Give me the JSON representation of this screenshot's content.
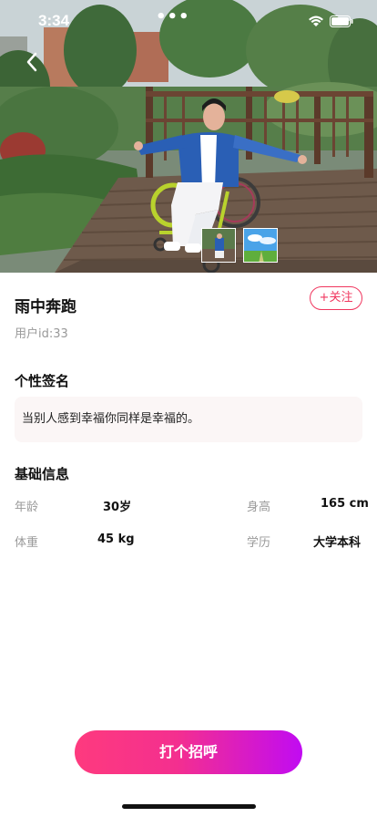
{
  "status_bar": {
    "time": "3:34",
    "dots": "•••",
    "icons": [
      "wifi-icon",
      "battery-icon"
    ]
  },
  "profile": {
    "name": "雨中奔跑",
    "user_id": "用户id:33",
    "follow_label": "+关注"
  },
  "signature": {
    "title": "个性签名",
    "text": "当别人感到幸福你同样是幸福的。"
  },
  "basic_info": {
    "title": "基础信息",
    "age_label": "年龄",
    "age_value": "30岁",
    "height_label": "身高",
    "height_value": "165 cm",
    "weight_label": "体重",
    "weight_value": "45 kg",
    "education_label": "学历",
    "education_value": "大学本科"
  },
  "action": {
    "greet_label": "打个招呼"
  },
  "colors": {
    "accent": "#f0365e",
    "gradient_start": "#fe3a7e",
    "gradient_end": "#c10bf2"
  }
}
